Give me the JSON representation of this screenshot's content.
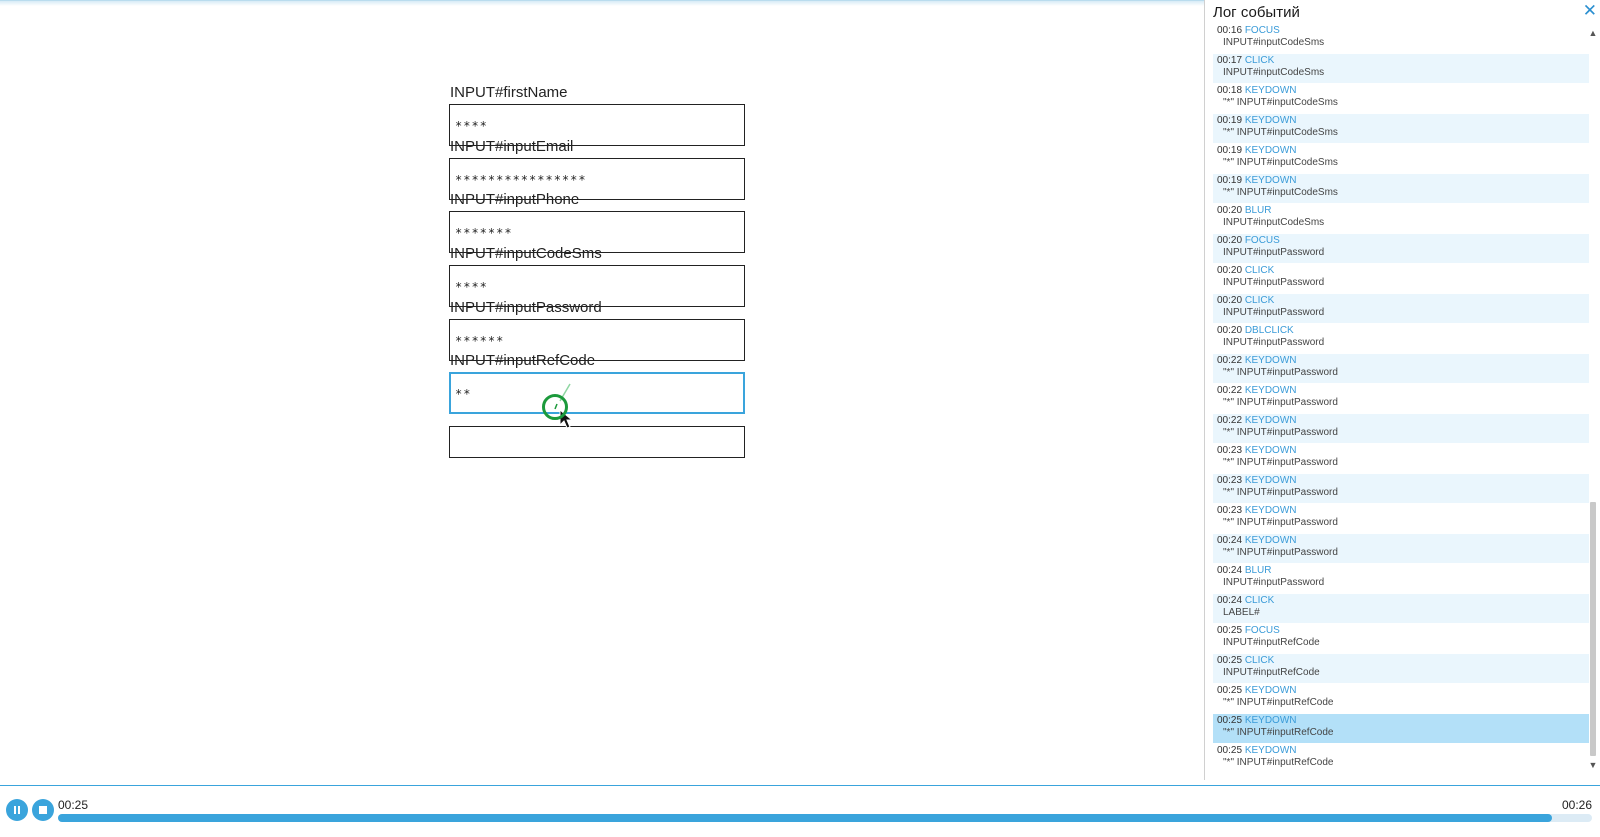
{
  "form": {
    "fields": [
      {
        "label": "INPUT#firstName",
        "value": "****"
      },
      {
        "label": "INPUT#inputEmail",
        "value": "****************"
      },
      {
        "label": "INPUT#inputPhone",
        "value": "*******"
      },
      {
        "label": "INPUT#inputCodeSms",
        "value": "****"
      },
      {
        "label": "INPUT#inputPassword",
        "value": "******"
      },
      {
        "label": "INPUT#inputRefCode",
        "value": "**"
      },
      {
        "label": "",
        "value": ""
      }
    ],
    "active_field_index": 5
  },
  "log": {
    "title": "Лог событий",
    "close_icon": "close-icon",
    "items": [
      {
        "time": "00:16",
        "type": "FOCUS",
        "target": "INPUT#inputCodeSms"
      },
      {
        "time": "00:17",
        "type": "CLICK",
        "target": "INPUT#inputCodeSms"
      },
      {
        "time": "00:18",
        "type": "KEYDOWN",
        "target": "\"*\" INPUT#inputCodeSms"
      },
      {
        "time": "00:19",
        "type": "KEYDOWN",
        "target": "\"*\" INPUT#inputCodeSms"
      },
      {
        "time": "00:19",
        "type": "KEYDOWN",
        "target": "\"*\" INPUT#inputCodeSms"
      },
      {
        "time": "00:19",
        "type": "KEYDOWN",
        "target": "\"*\" INPUT#inputCodeSms"
      },
      {
        "time": "00:20",
        "type": "BLUR",
        "target": "INPUT#inputCodeSms"
      },
      {
        "time": "00:20",
        "type": "FOCUS",
        "target": "INPUT#inputPassword"
      },
      {
        "time": "00:20",
        "type": "CLICK",
        "target": "INPUT#inputPassword"
      },
      {
        "time": "00:20",
        "type": "CLICK",
        "target": "INPUT#inputPassword"
      },
      {
        "time": "00:20",
        "type": "DBLCLICK",
        "target": "INPUT#inputPassword"
      },
      {
        "time": "00:22",
        "type": "KEYDOWN",
        "target": "\"*\" INPUT#inputPassword"
      },
      {
        "time": "00:22",
        "type": "KEYDOWN",
        "target": "\"*\" INPUT#inputPassword"
      },
      {
        "time": "00:22",
        "type": "KEYDOWN",
        "target": "\"*\" INPUT#inputPassword"
      },
      {
        "time": "00:23",
        "type": "KEYDOWN",
        "target": "\"*\" INPUT#inputPassword"
      },
      {
        "time": "00:23",
        "type": "KEYDOWN",
        "target": "\"*\" INPUT#inputPassword"
      },
      {
        "time": "00:23",
        "type": "KEYDOWN",
        "target": "\"*\" INPUT#inputPassword"
      },
      {
        "time": "00:24",
        "type": "KEYDOWN",
        "target": "\"*\" INPUT#inputPassword"
      },
      {
        "time": "00:24",
        "type": "BLUR",
        "target": "INPUT#inputPassword"
      },
      {
        "time": "00:24",
        "type": "CLICK",
        "target": "LABEL#"
      },
      {
        "time": "00:25",
        "type": "FOCUS",
        "target": "INPUT#inputRefCode"
      },
      {
        "time": "00:25",
        "type": "CLICK",
        "target": "INPUT#inputRefCode"
      },
      {
        "time": "00:25",
        "type": "KEYDOWN",
        "target": "\"*\" INPUT#inputRefCode"
      },
      {
        "time": "00:25",
        "type": "KEYDOWN",
        "target": "\"*\" INPUT#inputRefCode"
      },
      {
        "time": "00:25",
        "type": "KEYDOWN",
        "target": "\"*\" INPUT#inputRefCode"
      }
    ],
    "current_index": 23
  },
  "player": {
    "pause_icon": "pause-icon",
    "stop_icon": "stop-icon",
    "current_time": "00:25",
    "total_time": "00:26",
    "progress_fraction": 0.974
  },
  "colors": {
    "accent": "#3aa4dc",
    "cursor": "#1c9a3c",
    "log_highlight": "#b3e0f8"
  }
}
